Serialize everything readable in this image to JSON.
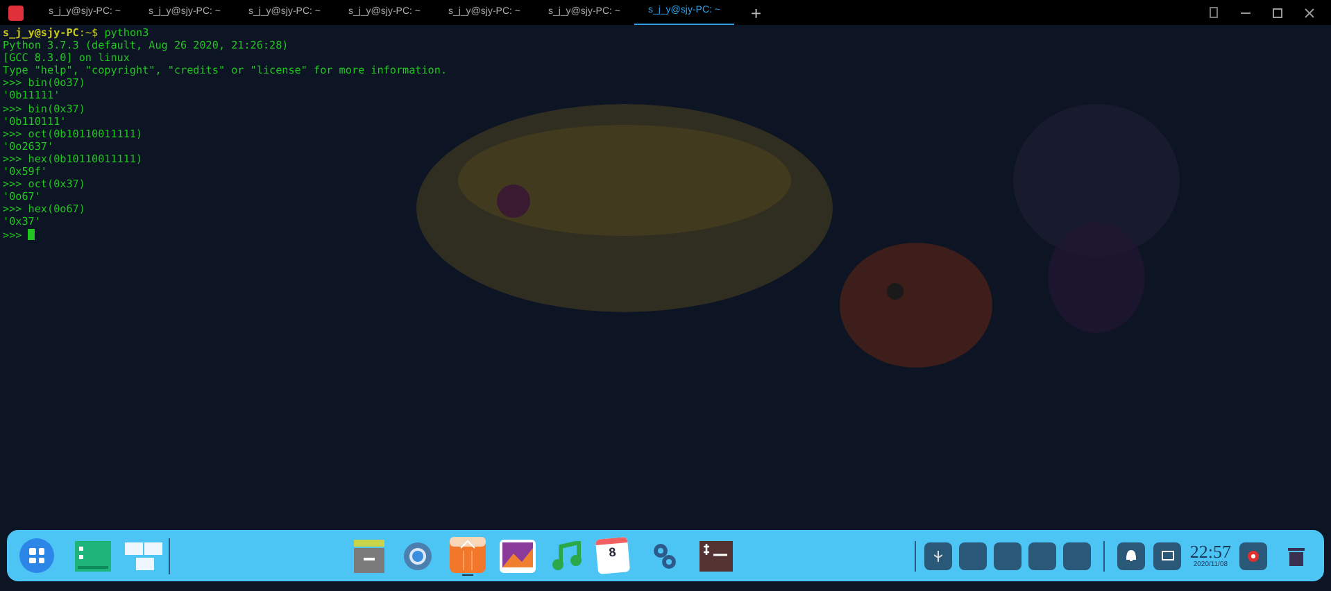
{
  "tabs": [
    {
      "label": "s_j_y@sjy-PC: ~",
      "selected": false
    },
    {
      "label": "s_j_y@sjy-PC: ~",
      "selected": false
    },
    {
      "label": "s_j_y@sjy-PC: ~",
      "selected": false
    },
    {
      "label": "s_j_y@sjy-PC: ~",
      "selected": false
    },
    {
      "label": "s_j_y@sjy-PC: ~",
      "selected": false
    },
    {
      "label": "s_j_y@sjy-PC: ~",
      "selected": false
    },
    {
      "label": "s_j_y@sjy-PC: ~",
      "selected": true
    }
  ],
  "new_tab": "+",
  "terminal": {
    "lines": [
      {
        "kind": "prompt",
        "user": "s_j_y@sjy-PC",
        "path": ":~$",
        "text": "python3"
      },
      {
        "kind": "output",
        "text": "Python 3.7.3 (default, Aug 26 2020, 21:26:28)"
      },
      {
        "kind": "output",
        "text": "[GCC 8.3.0] on linux"
      },
      {
        "kind": "output",
        "text": "Type \"help\", \"copyright\", \"credits\" or \"license\" for more information."
      },
      {
        "kind": "output",
        "text": ">>> bin(0o37)"
      },
      {
        "kind": "output",
        "text": "'0b11111'"
      },
      {
        "kind": "output",
        "text": ">>> bin(0x37)"
      },
      {
        "kind": "output",
        "text": "'0b110111'"
      },
      {
        "kind": "output",
        "text": ">>> oct(0b10110011111)"
      },
      {
        "kind": "output",
        "text": "'0o2637'"
      },
      {
        "kind": "output",
        "text": ">>> hex(0b10110011111)"
      },
      {
        "kind": "output",
        "text": "'0x59f'"
      },
      {
        "kind": "output",
        "text": ">>> oct(0x37)"
      },
      {
        "kind": "output",
        "text": "'0o67'"
      },
      {
        "kind": "output",
        "text": ">>> hex(0o67)"
      },
      {
        "kind": "output",
        "text": "'0x37'"
      },
      {
        "kind": "input",
        "text": ">>>"
      }
    ]
  },
  "dock": {
    "calendar_day": "8",
    "clock": {
      "time": "22:57",
      "date": "2020/11/08"
    }
  }
}
